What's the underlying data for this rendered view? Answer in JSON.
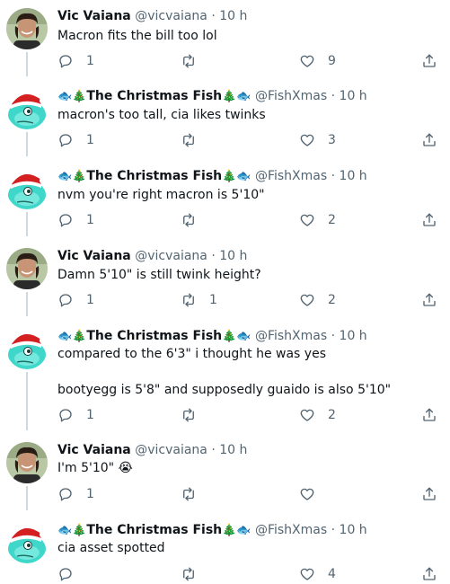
{
  "tweets": [
    {
      "author": "vic",
      "name": "Vic Vaiana",
      "handle": "@vicvaiana",
      "dot": "·",
      "time": "10 h",
      "text": "Macron fits the bill too lol",
      "replies": "1",
      "retweets": "",
      "likes": "9"
    },
    {
      "author": "fish",
      "emoji_left": "🐟🎄",
      "name": "The Christmas Fish",
      "emoji_right": "🎄🐟",
      "handle": "@FishXmas",
      "dot": "·",
      "time": "10 h",
      "text": "macron's too tall, cia likes twinks",
      "replies": "1",
      "retweets": "",
      "likes": "3"
    },
    {
      "author": "fish",
      "emoji_left": "🐟🎄",
      "name": "The Christmas Fish",
      "emoji_right": "🎄🐟",
      "handle": "@FishXmas",
      "dot": "·",
      "time": "10 h",
      "text": "nvm you're right macron is 5'10\"",
      "replies": "1",
      "retweets": "",
      "likes": "2"
    },
    {
      "author": "vic",
      "name": "Vic Vaiana",
      "handle": "@vicvaiana",
      "dot": "·",
      "time": "10 h",
      "text": "Damn 5'10\" is still twink height?",
      "replies": "1",
      "retweets": "1",
      "likes": "2"
    },
    {
      "author": "fish",
      "emoji_left": "🐟🎄",
      "name": "The Christmas Fish",
      "emoji_right": "🎄🐟",
      "handle": "@FishXmas",
      "dot": "·",
      "time": "10 h",
      "text": "compared to the 6'3\" i thought he was yes\n\nbootyegg is 5'8\" and supposedly guaido is also 5'10\"",
      "replies": "1",
      "retweets": "",
      "likes": "2"
    },
    {
      "author": "vic",
      "name": "Vic Vaiana",
      "handle": "@vicvaiana",
      "dot": "·",
      "time": "10 h",
      "text": "I'm 5'10\" 😭",
      "replies": "1",
      "retweets": "",
      "likes": ""
    },
    {
      "author": "fish",
      "emoji_left": "🐟🎄",
      "name": "The Christmas Fish",
      "emoji_right": "🎄🐟",
      "handle": "@FishXmas",
      "dot": "·",
      "time": "10 h",
      "text": "cia asset spotted",
      "replies": "",
      "retweets": "",
      "likes": "4"
    }
  ],
  "icons": {
    "reply": "reply-icon",
    "retweet": "retweet-icon",
    "like": "heart-icon",
    "share": "share-icon"
  },
  "colors": {
    "text": "#0f1419",
    "secondary": "#536471",
    "thread_line": "#cfd9de"
  }
}
